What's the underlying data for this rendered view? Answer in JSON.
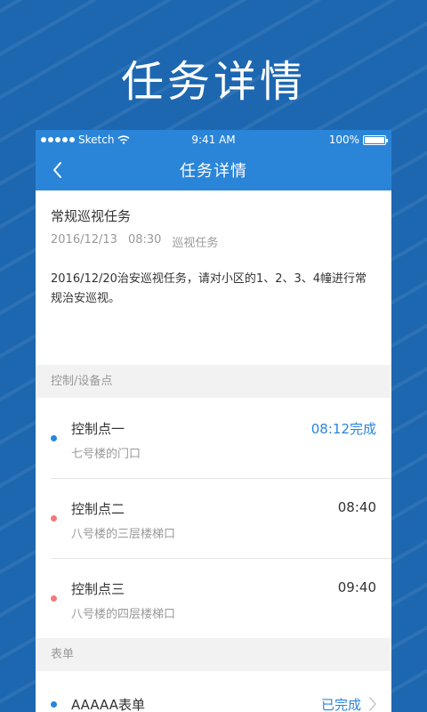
{
  "promo": {
    "title": "任务详情"
  },
  "statusbar": {
    "carrier": "Sketch",
    "time": "9:41 AM",
    "battery": "100%",
    "battery_level": 1.0
  },
  "navbar": {
    "title": "任务详情",
    "back_icon": "chevron-left-icon"
  },
  "task": {
    "name": "常规巡视任务",
    "date": "2016/12/13",
    "time": "08:30",
    "type": "巡视任务",
    "description": "2016/12/20治安巡视任务，请对小区的1、2、3、4幢进行常规治安巡视。"
  },
  "sections": {
    "control_points": "控制/设备点",
    "forms": "表单"
  },
  "control_points": [
    {
      "name": "控制点一",
      "location": "七号楼的门口",
      "time": "08:12完成",
      "dot_color": "#2a85d8",
      "done": true
    },
    {
      "name": "控制点二",
      "location": "八号楼的三层楼梯口",
      "time": "08:40",
      "dot_color": "#f07a7a",
      "done": false
    },
    {
      "name": "控制点三",
      "location": "八号楼的四层楼梯口",
      "time": "09:40",
      "dot_color": "#f07a7a",
      "done": false
    }
  ],
  "forms": [
    {
      "name": "AAAAA表单",
      "status": "已完成",
      "dot_color": "#2a85d8"
    }
  ],
  "colors": {
    "primary": "#2a85d8",
    "background": "#1d67b0",
    "pending": "#f07a7a"
  }
}
